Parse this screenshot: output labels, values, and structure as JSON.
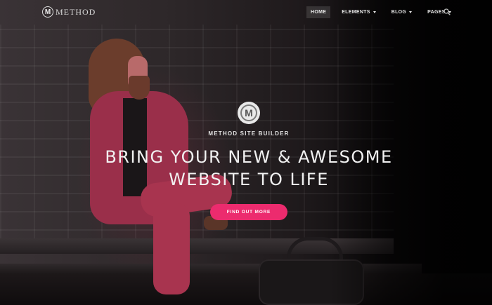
{
  "brand": {
    "name": "METHOD",
    "mark": "M"
  },
  "nav": {
    "items": [
      {
        "label": "HOME",
        "active": true,
        "dropdown": false
      },
      {
        "label": "ELEMENTS",
        "active": false,
        "dropdown": true
      },
      {
        "label": "BLOG",
        "active": false,
        "dropdown": true
      },
      {
        "label": "PAGES",
        "active": false,
        "dropdown": true
      }
    ],
    "search_icon": "search-icon"
  },
  "hero": {
    "badge_mark": "M",
    "subtitle": "METHOD SITE BUILDER",
    "headline_line1": "BRING YOUR NEW & AWESOME",
    "headline_line2": "WEBSITE TO LIFE",
    "cta_label": "FIND OUT MORE"
  },
  "colors": {
    "accent": "#ec2b6e",
    "jacket": "#9a2f4a",
    "text": "#f1f1f1"
  }
}
